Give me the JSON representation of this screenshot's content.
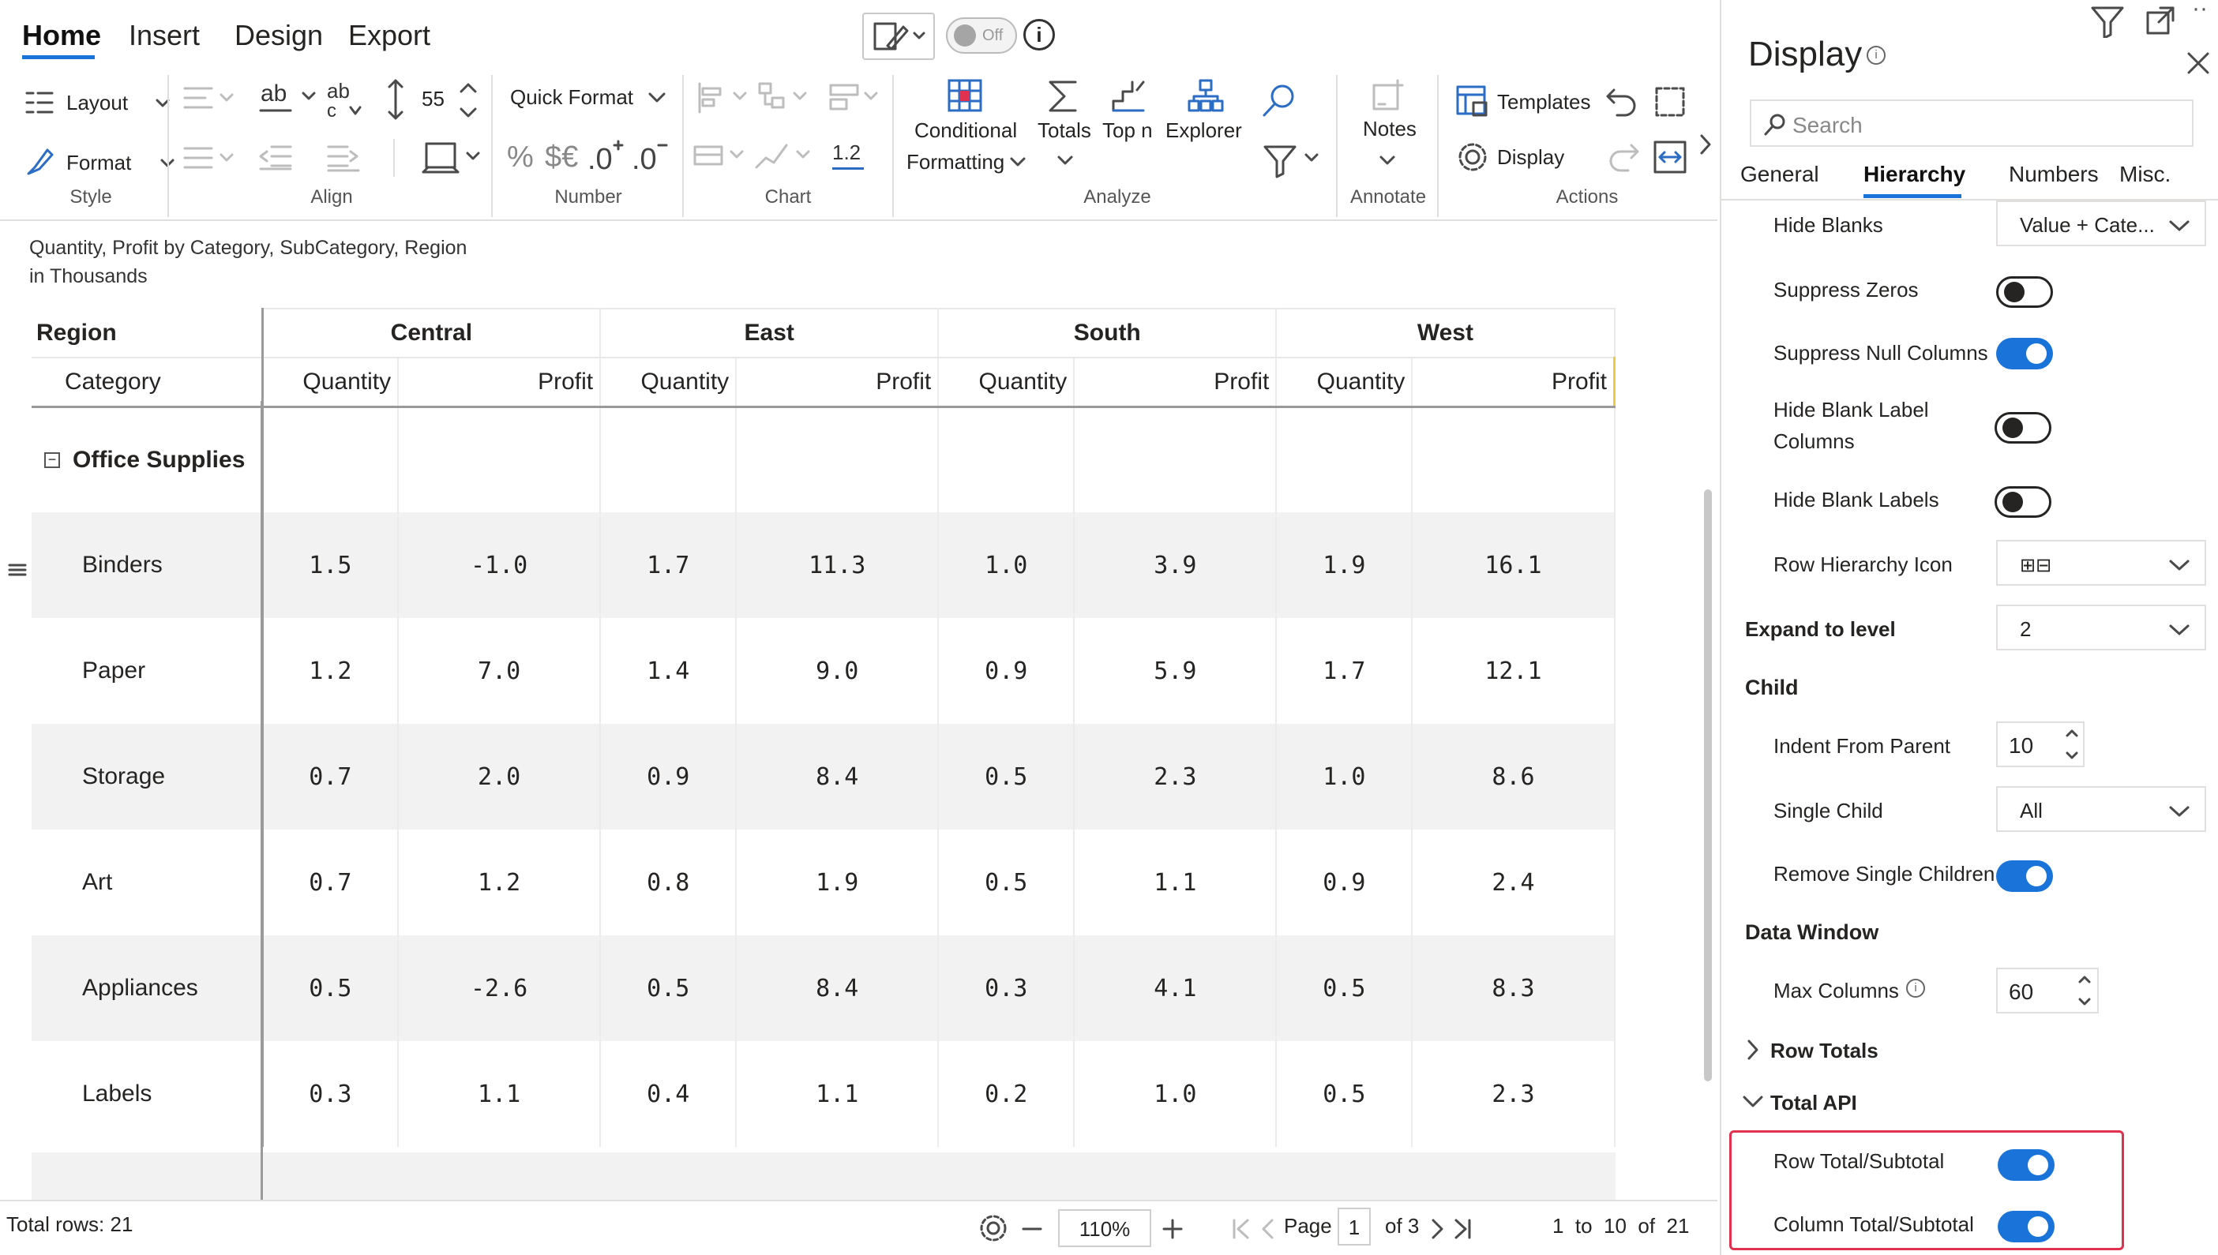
{
  "ribbon": {
    "tabs": [
      "Home",
      "Insert",
      "Design",
      "Export"
    ],
    "toggle_label": "Off",
    "font_size": "55",
    "quick_format": "Quick Format",
    "layout": "Layout",
    "format": "Format",
    "decimal_value": "1.2",
    "percent": "%",
    "currency": "$€",
    "conditional_formatting_1": "Conditional",
    "conditional_formatting_2": "Formatting",
    "totals": "Totals",
    "top_n": "Top n",
    "explorer": "Explorer",
    "notes": "Notes",
    "templates": "Templates",
    "display": "Display",
    "groups": {
      "style": "Style",
      "align": "Align",
      "number": "Number",
      "chart": "Chart",
      "analyze": "Analyze",
      "annotate": "Annotate",
      "actions": "Actions"
    }
  },
  "report": {
    "title": "Quantity, Profit by Category, SubCategory, Region",
    "subtitle": "in Thousands",
    "header": {
      "region_label": "Region",
      "category_label": "Category",
      "regions": [
        "Central",
        "East",
        "South",
        "West"
      ],
      "measures": [
        "Quantity",
        "Profit"
      ]
    },
    "group_row": "Office Supplies",
    "rows": [
      {
        "label": "Binders",
        "values": [
          "1.5",
          "-1.0",
          "1.7",
          "11.3",
          "1.0",
          "3.9",
          "1.9",
          "16.1"
        ]
      },
      {
        "label": "Paper",
        "values": [
          "1.2",
          "7.0",
          "1.4",
          "9.0",
          "0.9",
          "5.9",
          "1.7",
          "12.1"
        ]
      },
      {
        "label": "Storage",
        "values": [
          "0.7",
          "2.0",
          "0.9",
          "8.4",
          "0.5",
          "2.3",
          "1.0",
          "8.6"
        ]
      },
      {
        "label": "Art",
        "values": [
          "0.7",
          "1.2",
          "0.8",
          "1.9",
          "0.5",
          "1.1",
          "0.9",
          "2.4"
        ]
      },
      {
        "label": "Appliances",
        "values": [
          "0.5",
          "-2.6",
          "0.5",
          "8.4",
          "0.3",
          "4.1",
          "0.5",
          "8.3"
        ]
      },
      {
        "label": "Labels",
        "values": [
          "0.3",
          "1.1",
          "0.4",
          "1.1",
          "0.2",
          "1.0",
          "0.5",
          "2.3"
        ]
      }
    ]
  },
  "status": {
    "total_rows": "Total rows: 21",
    "zoom": "110%",
    "page_label": "Page",
    "page_value": "1",
    "page_of": "of 3",
    "range": "1  to  10  of  21"
  },
  "panel": {
    "title": "Display",
    "search_placeholder": "Search",
    "tabs": [
      "General",
      "Hierarchy",
      "Numbers",
      "Misc."
    ],
    "active_tab": "Hierarchy",
    "hide_blanks": {
      "label": "Hide Blanks",
      "value": "Value + Cate..."
    },
    "suppress_zeros": {
      "label": "Suppress Zeros",
      "on": false
    },
    "suppress_null_columns": {
      "label": "Suppress Null Columns",
      "on": true
    },
    "hide_blank_label_columns": {
      "label1": "Hide Blank Label",
      "label2": "Columns",
      "on": false
    },
    "hide_blank_labels": {
      "label": "Hide Blank Labels",
      "on": false
    },
    "row_hierarchy_icon": {
      "label": "Row Hierarchy Icon",
      "value": "⊞⊟"
    },
    "expand_to_level": {
      "label": "Expand to level",
      "value": "2"
    },
    "child_section": "Child",
    "indent_from_parent": {
      "label": "Indent From Parent",
      "value": "10"
    },
    "single_child": {
      "label": "Single Child",
      "value": "All"
    },
    "remove_single_children": {
      "label": "Remove Single Children",
      "on": true
    },
    "data_window_section": "Data Window",
    "max_columns": {
      "label": "Max Columns",
      "value": "60"
    },
    "row_totals_section": "Row Totals",
    "total_api_section": "Total API",
    "row_total_subtotal": {
      "label": "Row Total/Subtotal",
      "on": true
    },
    "column_total_subtotal": {
      "label": "Column Total/Subtotal",
      "on": true
    },
    "highlight_color": "#e0314f",
    "accent_color": "#1a73d9"
  }
}
